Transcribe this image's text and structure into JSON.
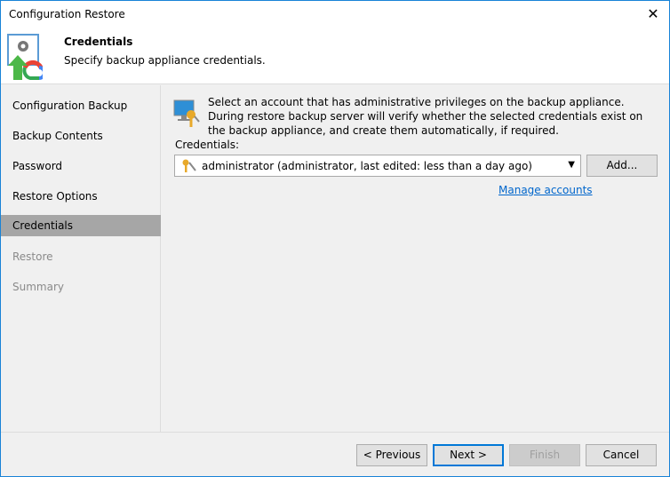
{
  "window": {
    "title": "Configuration Restore",
    "close": "✕"
  },
  "header": {
    "title": "Credentials",
    "subtitle": "Specify backup appliance credentials."
  },
  "sidebar": {
    "items": [
      {
        "label": "Configuration Backup",
        "state": "normal"
      },
      {
        "label": "Backup Contents",
        "state": "normal"
      },
      {
        "label": "Password",
        "state": "normal"
      },
      {
        "label": "Restore Options",
        "state": "normal"
      },
      {
        "label": "Credentials",
        "state": "selected"
      },
      {
        "label": "Restore",
        "state": "disabled"
      },
      {
        "label": "Summary",
        "state": "disabled"
      }
    ]
  },
  "main": {
    "info": "Select an account that has administrative privileges on the backup appliance. During restore backup server will verify whether the selected credentials exist on the backup appliance, and create them automatically, if required.",
    "credentials_label": "Credentials:",
    "credentials_value": "administrator (administrator, last edited: less than a day ago)",
    "add_label": "Add...",
    "manage_link": "Manage accounts"
  },
  "footer": {
    "previous": "< Previous",
    "next": "Next >",
    "finish": "Finish",
    "cancel": "Cancel"
  }
}
